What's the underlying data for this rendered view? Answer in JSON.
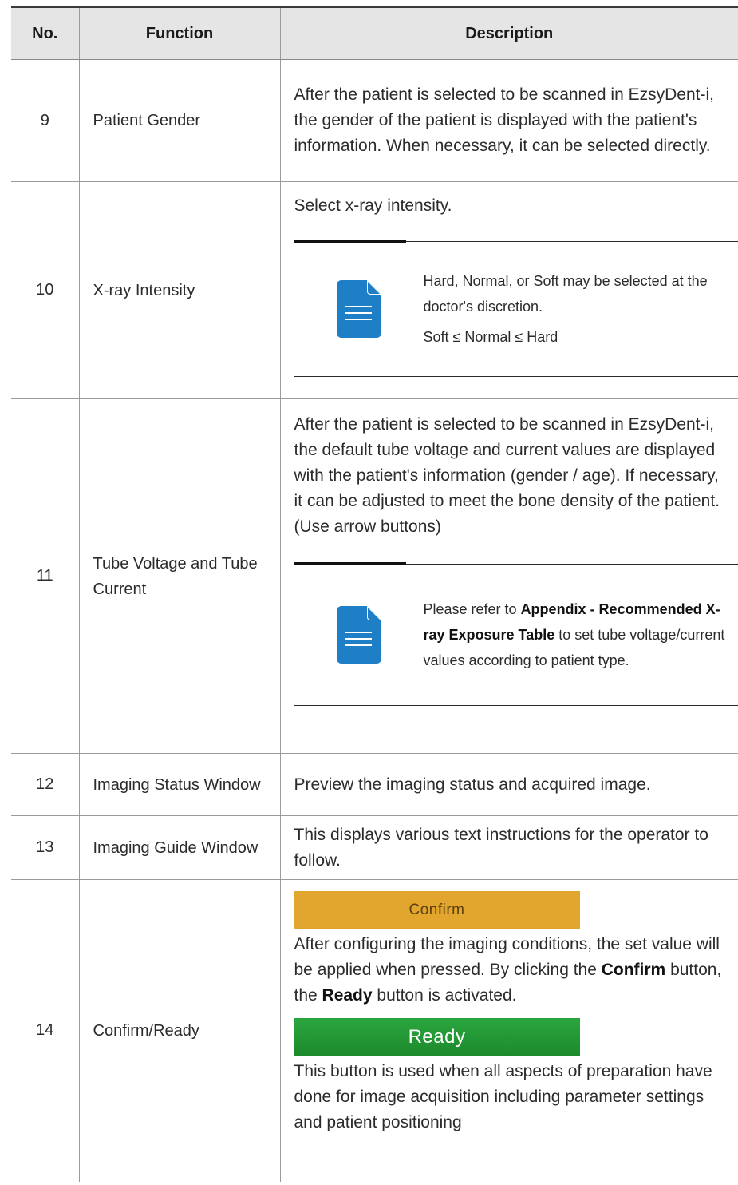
{
  "headers": {
    "no": "No.",
    "function": "Function",
    "description": "Description"
  },
  "rows": {
    "r9": {
      "no": "9",
      "function": "Patient Gender",
      "description": "After the patient is selected to be scanned in EzsyDent-i, the gender of the patient is displayed with the patient's information. When necessary, it can be selected directly."
    },
    "r10": {
      "no": "10",
      "function": "X-ray Intensity",
      "description": "Select x-ray intensity.",
      "note_line1": "Hard, Normal, or Soft may be selected at the doctor's discretion.",
      "note_line2": "Soft ≤ Normal ≤ Hard"
    },
    "r11": {
      "no": "11",
      "function": "Tube Voltage and Tube Current",
      "description": "After the patient is selected to be scanned in EzsyDent-i, the default tube voltage and current values are displayed with the patient's information (gender / age). If necessary, it can be adjusted to meet the bone density of the patient. (Use arrow buttons)",
      "note_pre": "Please refer to ",
      "note_bold": "Appendix - Recommended X-ray Exposure Table",
      "note_post": " to set tube voltage/current values according to patient type."
    },
    "r12": {
      "no": "12",
      "function": "Imaging Status Window",
      "description": "Preview the imaging status and acquired image."
    },
    "r13": {
      "no": "13",
      "function": "Imaging Guide Window",
      "description": "This displays various text instructions for the operator to follow."
    },
    "r14": {
      "no": "14",
      "function": "Confirm/Ready",
      "confirm_label": "Confirm",
      "text1_a": "After configuring the imaging conditions, the set value will be applied when pressed. By clicking the ",
      "text1_b": "Confirm",
      "text1_c": " button, the ",
      "text1_d": "Ready",
      "text1_e": " button is activated.",
      "ready_label": "Ready",
      "text2": "This button is used when all aspects of preparation have done for image acquisition including parameter settings and patient positioning"
    }
  },
  "colors": {
    "note_icon": "#1e7fc6",
    "confirm": "#e2a62e",
    "ready": "#2aa63f",
    "header_bg": "#e5e5e5"
  }
}
